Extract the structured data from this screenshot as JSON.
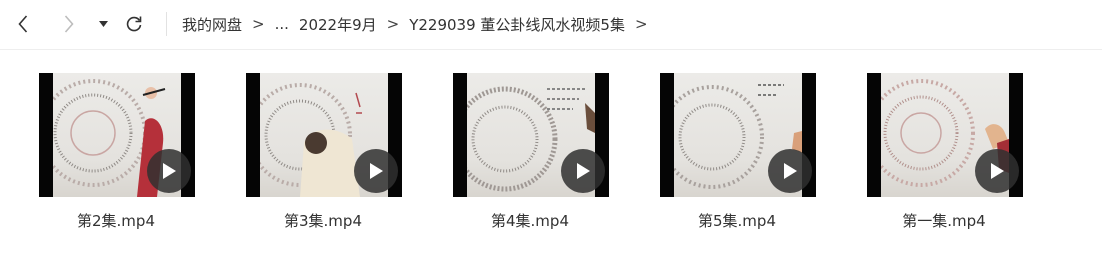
{
  "toolbar": {
    "back_icon": "chevron-left-icon",
    "forward_icon": "chevron-right-icon",
    "dropdown_icon": "caret-down-icon",
    "refresh_icon": "refresh-icon"
  },
  "breadcrumb": {
    "items": [
      "我的网盘",
      "...",
      "2022年9月",
      "Y229039 董公卦线风水视频5集"
    ],
    "separator": ">"
  },
  "files": [
    {
      "name": "第2集.mp4",
      "type": "video"
    },
    {
      "name": "第3集.mp4",
      "type": "video"
    },
    {
      "name": "第4集.mp4",
      "type": "video"
    },
    {
      "name": "第5集.mp4",
      "type": "video"
    },
    {
      "name": "第一集.mp4",
      "type": "video"
    }
  ],
  "colors": {
    "text": "#333333",
    "thumbnail_bg": "#050505",
    "play_button": "#303030",
    "divider": "#eeeeee"
  }
}
